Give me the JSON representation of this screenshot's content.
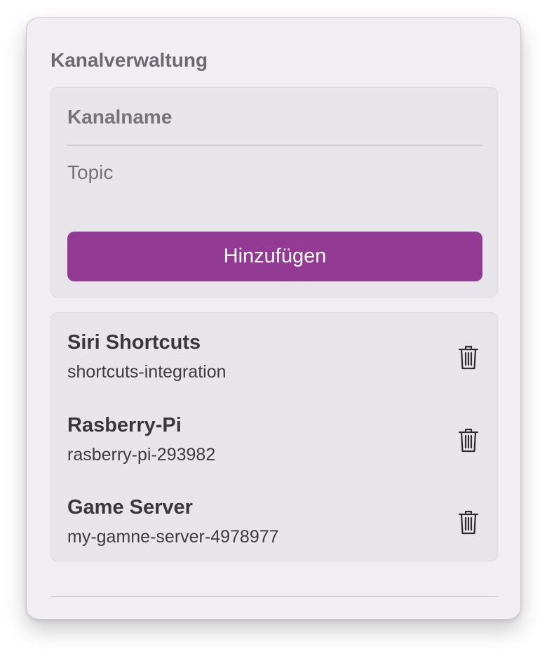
{
  "panel": {
    "title": "Kanalverwaltung"
  },
  "form": {
    "name_placeholder": "Kanalname",
    "topic_placeholder": "Topic",
    "add_button_label": "Hinzufügen"
  },
  "channels": [
    {
      "name": "Siri Shortcuts",
      "topic": "shortcuts-integration",
      "delete_icon": "trash-icon"
    },
    {
      "name": "Rasberry-Pi",
      "topic": "rasberry-pi-293982",
      "delete_icon": "trash-icon"
    },
    {
      "name": "Game Server",
      "topic": "my-gamne-server-4978977",
      "delete_icon": "trash-icon"
    }
  ],
  "colors": {
    "accent": "#933a94",
    "panel_background": "#f0eef3",
    "group_background": "#e7e5ea"
  }
}
